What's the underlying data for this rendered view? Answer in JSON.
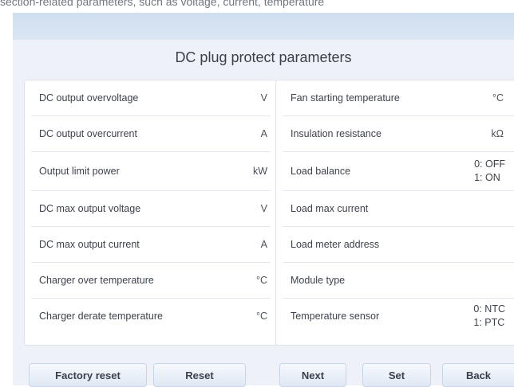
{
  "top_caption": "section-related parameters, such as voltage, current, temperature",
  "title": "DC plug protect parameters",
  "left_rows": [
    {
      "label": "DC output overvoltage",
      "unit": "V"
    },
    {
      "label": "DC output overcurrent",
      "unit": "A"
    },
    {
      "label": "Output limit power",
      "unit": "kW"
    },
    {
      "label": "DC max output voltage",
      "unit": "V"
    },
    {
      "label": "DC max output current",
      "unit": "A"
    },
    {
      "label": "Charger over temperature",
      "unit": "°C"
    },
    {
      "label": "Charger derate temperature",
      "unit": "°C"
    }
  ],
  "right_rows": [
    {
      "label": "Fan starting temperature",
      "unit": "°C"
    },
    {
      "label": "Insulation resistance",
      "unit": "kΩ"
    },
    {
      "label": "Load balance",
      "opt1": "0: OFF",
      "opt2": "1: ON"
    },
    {
      "label": "Load max current"
    },
    {
      "label": "Load meter address"
    },
    {
      "label": "Module type"
    },
    {
      "label": "Temperature sensor",
      "opt1": "0: NTC",
      "opt2": "1: PTC"
    }
  ],
  "buttons": {
    "factory_reset": "Factory reset",
    "reset": "Reset",
    "next": "Next",
    "set": "Set",
    "back": "Back"
  }
}
